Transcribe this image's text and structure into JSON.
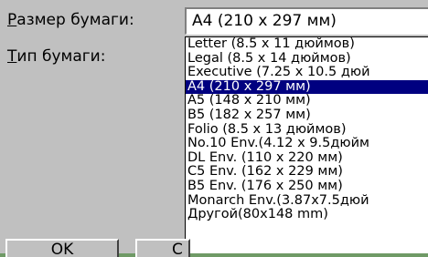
{
  "paper_size": {
    "label_accel": "Р",
    "label_rest": "азмер бумаги:",
    "value": "A4 (210 x 297 мм)"
  },
  "paper_type": {
    "label_accel": "Т",
    "label_rest": "ип бумаги:"
  },
  "options": [
    "Letter (8.5 x 11 дюймов)",
    "Legal (8.5 x 14 дюймов)",
    "Executive (7.25 x 10.5 дюй",
    "A4 (210 x 297 мм)",
    "A5 (148 x 210 мм)",
    "B5 (182 x 257 мм)",
    "Folio (8.5 x 13 дюймов)",
    "No.10 Env.(4.12 x 9.5дюйм",
    "DL Env. (110 x 220 мм)",
    "C5 Env. (162 x 229 мм)",
    "B5 Env. (176 x 250 мм)",
    "Monarch Env.(3.87x7.5дюй",
    "Другой(80x148 mm)"
  ],
  "selected_index": 3,
  "buttons": {
    "ok": "OK",
    "cancel": "С"
  },
  "colors": {
    "highlight": "#000080",
    "dialog_bg": "#c0c0c0",
    "outer_bg": "#6f9a66"
  }
}
